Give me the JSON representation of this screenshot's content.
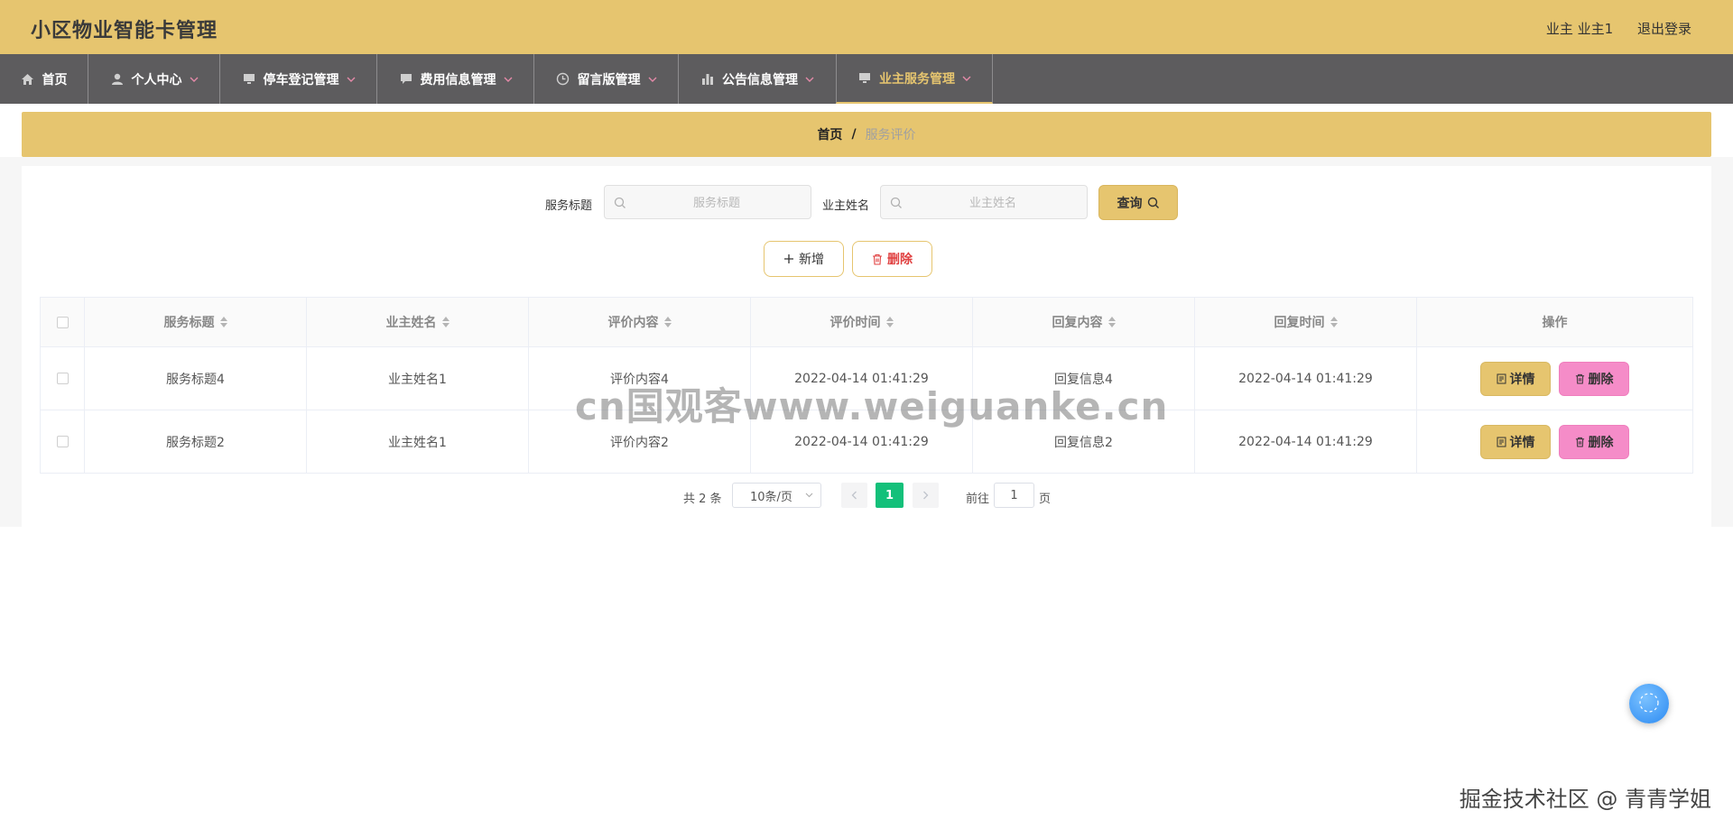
{
  "app": {
    "title": "小区物业智能卡管理"
  },
  "user": {
    "role_name": "业主 业主1",
    "logout": "退出登录"
  },
  "nav": [
    {
      "label": "首页",
      "icon": "home-icon"
    },
    {
      "label": "个人中心",
      "icon": "person-icon"
    },
    {
      "label": "停车登记管理",
      "icon": "monitor-icon"
    },
    {
      "label": "费用信息管理",
      "icon": "chat-icon"
    },
    {
      "label": "留言版管理",
      "icon": "clock-icon"
    },
    {
      "label": "公告信息管理",
      "icon": "bar-chart-icon"
    },
    {
      "label": "业主服务管理",
      "icon": "monitor-icon"
    }
  ],
  "breadcrumb": {
    "home": "首页",
    "sep": "/",
    "current": "服务评价"
  },
  "search": {
    "title_label": "服务标题",
    "title_placeholder": "服务标题",
    "owner_label": "业主姓名",
    "owner_placeholder": "业主姓名",
    "query_button": "查询"
  },
  "actions": {
    "add": "新增",
    "delete": "删除"
  },
  "table": {
    "headers": [
      "服务标题",
      "业主姓名",
      "评价内容",
      "评价时间",
      "回复内容",
      "回复时间",
      "操作"
    ],
    "rows": [
      {
        "title": "服务标题4",
        "owner": "业主姓名1",
        "content": "评价内容4",
        "eval_time": "2022-04-14 01:41:29",
        "reply": "回复信息4",
        "reply_time": "2022-04-14 01:41:29"
      },
      {
        "title": "服务标题2",
        "owner": "业主姓名1",
        "content": "评价内容2",
        "eval_time": "2022-04-14 01:41:29",
        "reply": "回复信息2",
        "reply_time": "2022-04-14 01:41:29"
      }
    ],
    "row_actions": {
      "detail": "详情",
      "delete": "删除"
    }
  },
  "pagination": {
    "total": "共 2 条",
    "page_size": "10条/页",
    "current_page": "1",
    "goto_label": "前往",
    "goto_value": "1",
    "goto_suffix": "页"
  },
  "overlay": {
    "watermark": "cn国观客www.weiguanke.cn",
    "footer": "掘金技术社区 @ 青青学姐"
  },
  "colors": {
    "accent": "#e6c56f",
    "nav_bg": "#5d5c5e",
    "page_active": "#13c07a",
    "row_delete": "#f58cc8",
    "danger_text": "#e04040"
  }
}
